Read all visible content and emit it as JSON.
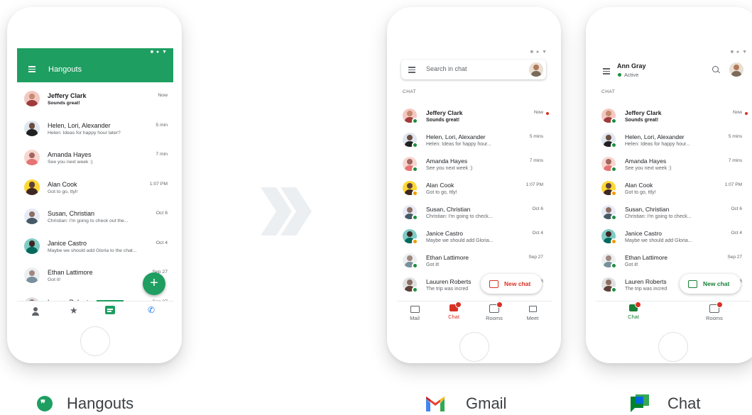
{
  "colors": {
    "hangouts_green": "#1e9e61",
    "gmail_red": "#d93025",
    "chat_green": "#188038",
    "active_green": "#1e8e3e",
    "away_orange": "#f29900"
  },
  "hangouts": {
    "title": "Hangouts",
    "conversations": [
      {
        "name": "Jeffery Clark",
        "snippet": "Sounds great!",
        "time": "Now",
        "unread": true
      },
      {
        "name": "Helen, Lori, Alexander",
        "snippet": "Helen: Ideas for happy hour later?",
        "time": "5 min"
      },
      {
        "name": "Amanda Hayes",
        "snippet": "See you next week :)",
        "time": "7 min"
      },
      {
        "name": "Alan Cook",
        "snippet": "Got to go, ttyl!",
        "time": "1:07 PM"
      },
      {
        "name": "Susan, Christian",
        "snippet": "Christian: I'm going to check out the...",
        "time": "Oct 6"
      },
      {
        "name": "Janice Castro",
        "snippet": "Maybe we should add Gloria to the chat...",
        "time": "Oct 4"
      },
      {
        "name": "Ethan Lattimore",
        "snippet": "Got it!",
        "time": "Sep 27"
      },
      {
        "name": "Lauren Roberts",
        "snippet": "",
        "time": "Sep 27"
      }
    ],
    "fab_label": "+",
    "nav_icons": [
      "person-icon",
      "star-icon",
      "chat-icon",
      "phone-icon"
    ]
  },
  "gmail": {
    "search_placeholder": "Search in chat",
    "section_label": "CHAT",
    "conversations": [
      {
        "name": "Jeffery Clark",
        "snippet": "Sounds great!",
        "time": "Now",
        "unread": true
      },
      {
        "name": "Helen, Lori, Alexander",
        "snippet": "Helen: Ideas for happy hour...",
        "time": "5 mins"
      },
      {
        "name": "Amanda Hayes",
        "snippet": "See you next week :)",
        "time": "7 mins"
      },
      {
        "name": "Alan Cook",
        "snippet": "Got to go, ttly!",
        "time": "1:07 PM"
      },
      {
        "name": "Susan, Christian",
        "snippet": "Christian: I'm going to check...",
        "time": "Oct 6"
      },
      {
        "name": "Janice Castro",
        "snippet": "Maybe we should add Gloria...",
        "time": "Oct 4"
      },
      {
        "name": "Ethan Lattimore",
        "snippet": "Got it!",
        "time": "Sep 27"
      },
      {
        "name": "Lauuren Roberts",
        "snippet": "The trip was incred",
        "time": "Sep 26"
      }
    ],
    "new_chat_label": "New chat",
    "nav": [
      {
        "label": "Mail",
        "icon": "mail-icon"
      },
      {
        "label": "Chat",
        "icon": "chat-icon",
        "active": true
      },
      {
        "label": "Rooms",
        "icon": "rooms-icon"
      },
      {
        "label": "Meet",
        "icon": "video-icon"
      }
    ]
  },
  "chat": {
    "user_name": "Ann Gray",
    "user_status": "Active",
    "section_label": "CHAT",
    "conversations": [
      {
        "name": "Jeffery Clark",
        "snippet": "Sounds great!",
        "time": "Now",
        "unread": true
      },
      {
        "name": "Helen, Lori, Alexander",
        "snippet": "Helen: Ideas for happy hour...",
        "time": "5 mins"
      },
      {
        "name": "Amanda Hayes",
        "snippet": "See you next week :)",
        "time": "7 mins"
      },
      {
        "name": "Alan Cook",
        "snippet": "Got to go, ttly!",
        "time": "1:07 PM"
      },
      {
        "name": "Susan, Christian",
        "snippet": "Christian: I'm going to check...",
        "time": "Oct 6"
      },
      {
        "name": "Janice Castro",
        "snippet": "Maybe we should add Gloria...",
        "time": "Oct 4"
      },
      {
        "name": "Ethan Lattimore",
        "snippet": "Got it!",
        "time": "Sep 27"
      },
      {
        "name": "Lauren Roberts",
        "snippet": "The trip was incred",
        "time": "Sep 26"
      }
    ],
    "new_chat_label": "New chat",
    "nav": [
      {
        "label": "Chat",
        "icon": "chat-icon",
        "active": true
      },
      {
        "label": "Rooms",
        "icon": "rooms-icon"
      }
    ]
  },
  "captions": {
    "hangouts": "Hangouts",
    "gmail": "Gmail",
    "chat": "Chat"
  },
  "arrow_icon": "double-chevron-right-icon"
}
